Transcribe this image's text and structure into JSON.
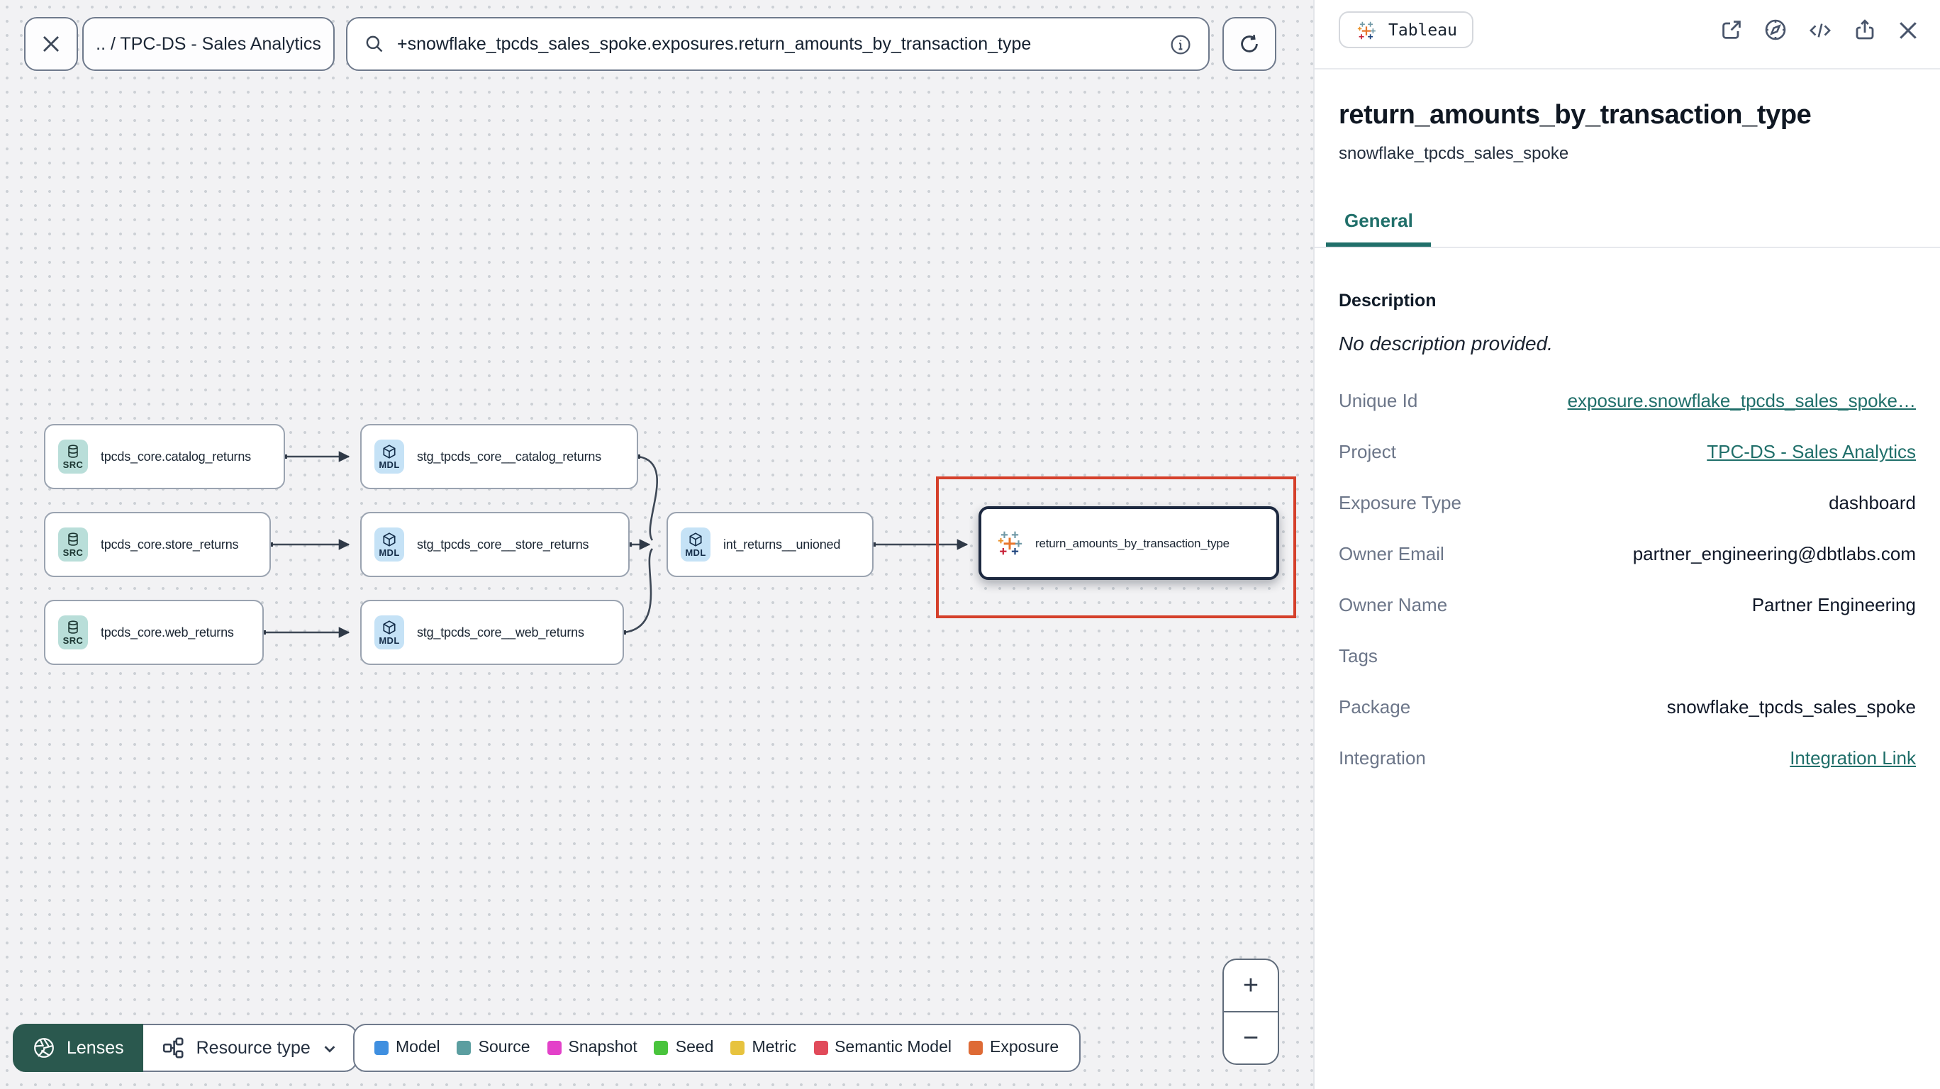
{
  "topbar": {
    "breadcrumb": ".. / TPC-DS - Sales Analytics",
    "search_value": "+snowflake_tpcds_sales_spoke.exposures.return_amounts_by_transaction_type"
  },
  "panel": {
    "badge_label": "Tableau",
    "title": "return_amounts_by_transaction_type",
    "subtitle": "snowflake_tpcds_sales_spoke",
    "tab_general": "General",
    "description_heading": "Description",
    "description_empty": "No description provided.",
    "fields": [
      {
        "label": "Unique Id",
        "value": "exposure.snowflake_tpcds_sales_spoke…",
        "type": "link"
      },
      {
        "label": "Project",
        "value": "TPC-DS - Sales Analytics",
        "type": "link"
      },
      {
        "label": "Exposure Type",
        "value": "dashboard",
        "type": "text"
      },
      {
        "label": "Owner Email",
        "value": "partner_engineering@dbtlabs.com",
        "type": "text"
      },
      {
        "label": "Owner Name",
        "value": "Partner Engineering",
        "type": "text"
      },
      {
        "label": "Tags",
        "value": "",
        "type": "text"
      },
      {
        "label": "Package",
        "value": "snowflake_tpcds_sales_spoke",
        "type": "text"
      },
      {
        "label": "Integration",
        "value": "Integration Link",
        "type": "link"
      }
    ]
  },
  "graph": {
    "nodes": [
      {
        "badge": "SRC",
        "label": "tpcds_core.catalog_returns",
        "kind": "source"
      },
      {
        "badge": "SRC",
        "label": "tpcds_core.store_returns",
        "kind": "source"
      },
      {
        "badge": "SRC",
        "label": "tpcds_core.web_returns",
        "kind": "source"
      },
      {
        "badge": "MDL",
        "label": "stg_tpcds_core__catalog_returns",
        "kind": "model"
      },
      {
        "badge": "MDL",
        "label": "stg_tpcds_core__store_returns",
        "kind": "model"
      },
      {
        "badge": "MDL",
        "label": "stg_tpcds_core__web_returns",
        "kind": "model"
      },
      {
        "badge": "MDL",
        "label": "int_returns__unioned",
        "kind": "model"
      },
      {
        "badge": "tableau-icon",
        "label": "return_amounts_by_transaction_type",
        "kind": "exposure",
        "selected": true
      }
    ],
    "selection_color": "#d5402b"
  },
  "footer": {
    "lenses_label": "Lenses",
    "resource_type_label": "Resource type",
    "legend": [
      {
        "label": "Model",
        "color": "#3f8fe0"
      },
      {
        "label": "Source",
        "color": "#5b9ea0"
      },
      {
        "label": "Snapshot",
        "color": "#e341c9"
      },
      {
        "label": "Seed",
        "color": "#49c43c"
      },
      {
        "label": "Metric",
        "color": "#e7c33e"
      },
      {
        "label": "Semantic Model",
        "color": "#e14a5a"
      },
      {
        "label": "Exposure",
        "color": "#de6a35"
      }
    ]
  },
  "zoom_controls": {
    "zoom_in": "+",
    "zoom_out": "−"
  },
  "colors": {
    "accent_teal": "#206f6a",
    "lenses_green": "#2a584e",
    "selection_red": "#d5402b",
    "source_badge_bg": "#b9ded9",
    "model_badge_bg": "#c5e2f6"
  }
}
